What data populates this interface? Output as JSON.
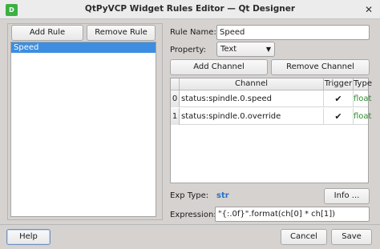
{
  "window": {
    "title": "QtPyVCP Widget Rules Editor — Qt Designer",
    "icon_label": "D",
    "close_glyph": "✕"
  },
  "rules_panel": {
    "add_rule_label": "Add Rule",
    "remove_rule_label": "Remove Rule",
    "rules": [
      "Speed"
    ]
  },
  "rule_form": {
    "rule_name_label": "Rule Name:",
    "rule_name_value": "Speed",
    "property_label": "Property:",
    "property_value": "Text",
    "add_channel_label": "Add Channel",
    "remove_channel_label": "Remove Channel"
  },
  "channels": {
    "headers": [
      "Channel",
      "Trigger",
      "Type"
    ],
    "rows": [
      {
        "index": "0",
        "channel": "status:spindle.0.speed",
        "trigger": "✔",
        "type": "float"
      },
      {
        "index": "1",
        "channel": "status:spindle.0.override",
        "trigger": "✔",
        "type": "float"
      }
    ]
  },
  "expression": {
    "exp_type_label": "Exp Type:",
    "exp_type_value": "str",
    "info_label": "Info ...",
    "expression_label": "Expression:",
    "expression_value": "\"{:.0f}\".format(ch[0] * ch[1])"
  },
  "footer": {
    "help_label": "Help",
    "cancel_label": "Cancel",
    "save_label": "Save"
  }
}
